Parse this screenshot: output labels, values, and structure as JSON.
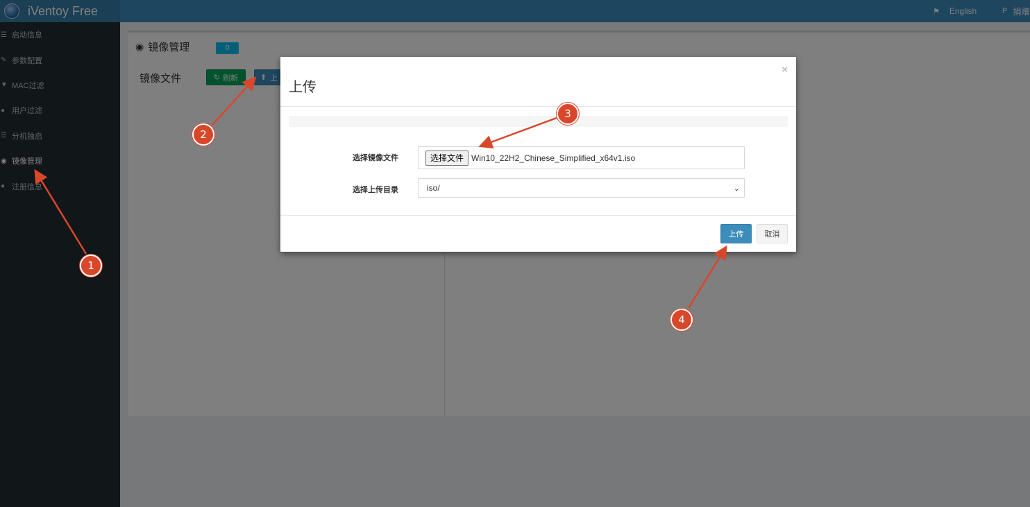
{
  "header": {
    "app_title": "iVentoy Free",
    "language_label": "English",
    "donate_label": "捐赠",
    "language_icon": "flag-icon",
    "donate_icon": "paypal-icon"
  },
  "sidebar": {
    "items": [
      {
        "label": "启动信息",
        "icon": "list-icon"
      },
      {
        "label": "参数配置",
        "icon": "wrench-icon"
      },
      {
        "label": "MAC过滤",
        "icon": "filter-icon"
      },
      {
        "label": "用户过滤",
        "icon": "user-icon"
      },
      {
        "label": "分机独启",
        "icon": "list-icon"
      },
      {
        "label": "镜像管理",
        "icon": "globe-icon"
      },
      {
        "label": "注册信息",
        "icon": "user-icon"
      }
    ]
  },
  "main": {
    "title": "镜像管理",
    "count_badge": "0",
    "section_label": "镜像文件",
    "refresh_label": "刷新",
    "upload_label": "上",
    "partial_text": "。"
  },
  "modal": {
    "title": "上传",
    "close_symbol": "×",
    "progress": 0,
    "file_label": "选择镜像文件",
    "file_button": "选择文件",
    "file_name": "Win10_22H2_Chinese_Simplified_x64v1.iso",
    "dir_label": "选择上传目录",
    "dir_selected": "iso/",
    "ok_label": "上传",
    "cancel_label": "取消"
  },
  "annotations": {
    "markers": [
      "1",
      "2",
      "3",
      "4"
    ],
    "color": "#d9472b"
  },
  "colors": {
    "header": "#3c8dbc",
    "sidebar": "#222d32",
    "refresh": "#00a65a",
    "primary": "#3c8dbc"
  }
}
